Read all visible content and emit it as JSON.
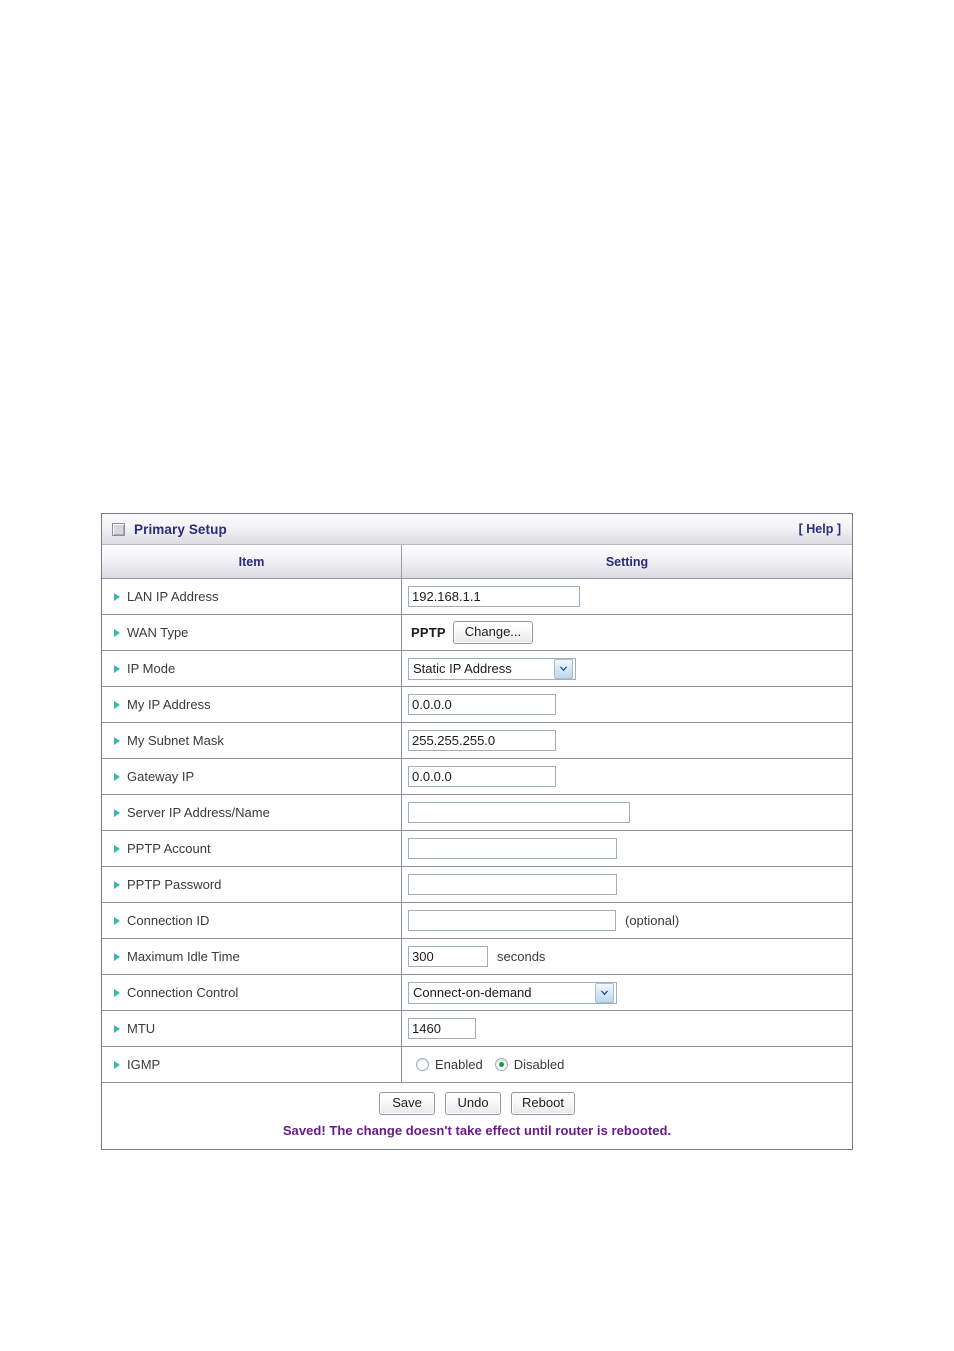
{
  "panel": {
    "title": "Primary Setup",
    "title_icon": "window-square-icon",
    "help_label": "[ Help ]",
    "columns": {
      "item": "Item",
      "setting": "Setting"
    }
  },
  "rows": [
    {
      "label": "LAN IP Address",
      "control": "text",
      "value": "192.168.1.1"
    },
    {
      "label": "WAN Type",
      "control": "wantype",
      "value": "PPTP",
      "button": "Change..."
    },
    {
      "label": "IP Mode",
      "control": "select",
      "value": "Static IP Address"
    },
    {
      "label": "My IP Address",
      "control": "text",
      "value": "0.0.0.0"
    },
    {
      "label": "My Subnet Mask",
      "control": "text",
      "value": "255.255.255.0"
    },
    {
      "label": "Gateway IP",
      "control": "text",
      "value": "0.0.0.0"
    },
    {
      "label": "Server IP Address/Name",
      "control": "text",
      "value": ""
    },
    {
      "label": "PPTP Account",
      "control": "text",
      "value": ""
    },
    {
      "label": "PPTP Password",
      "control": "text",
      "value": ""
    },
    {
      "label": "Connection ID",
      "control": "text",
      "value": "",
      "suffix": "(optional)"
    },
    {
      "label": "Maximum Idle Time",
      "control": "text",
      "value": "300",
      "suffix": "seconds"
    },
    {
      "label": "Connection Control",
      "control": "select",
      "value": "Connect-on-demand"
    },
    {
      "label": "MTU",
      "control": "text",
      "value": "1460"
    },
    {
      "label": "IGMP",
      "control": "radio",
      "options": [
        "Enabled",
        "Disabled"
      ],
      "selected": "Disabled"
    }
  ],
  "footer": {
    "save_label": "Save",
    "undo_label": "Undo",
    "reboot_label": "Reboot",
    "status_message": "Saved! The change doesn't take effect until router is rebooted."
  },
  "colors": {
    "heading_blue": "#2a2a80",
    "bullet_teal": "#39b7ad",
    "status_purple": "#6b1a8c",
    "radio_dot_green": "#1a9b3c"
  }
}
